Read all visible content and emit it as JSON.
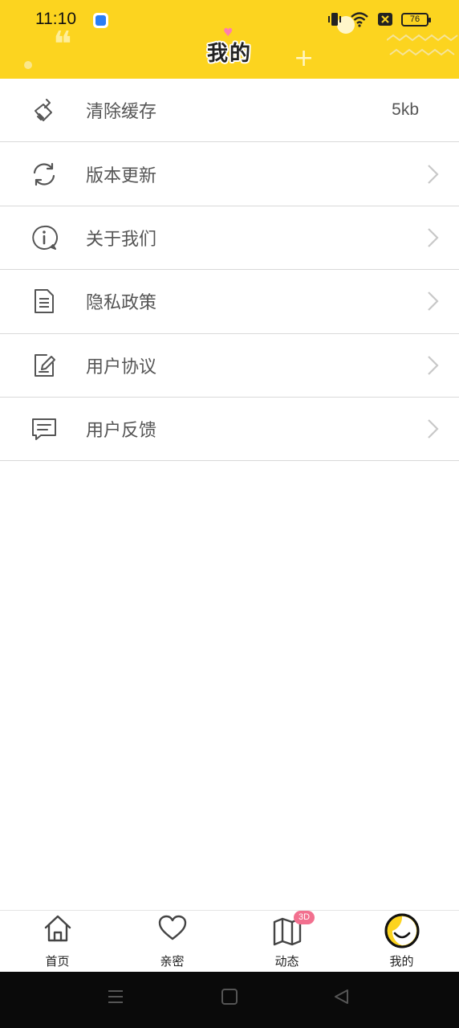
{
  "status_bar": {
    "time": "11:10",
    "battery": "76"
  },
  "header": {
    "title": "我的",
    "background_color": "#fcd41f"
  },
  "menu": {
    "items": [
      {
        "label": "清除缓存",
        "value": "5kb",
        "icon": "broom-icon"
      },
      {
        "label": "版本更新",
        "icon": "refresh-icon"
      },
      {
        "label": "关于我们",
        "icon": "info-bubble-icon"
      },
      {
        "label": "隐私政策",
        "icon": "document-icon"
      },
      {
        "label": "用户协议",
        "icon": "edit-note-icon"
      },
      {
        "label": "用户反馈",
        "icon": "message-icon"
      }
    ]
  },
  "tabbar": {
    "tabs": [
      {
        "label": "首页",
        "icon": "home-icon"
      },
      {
        "label": "亲密",
        "icon": "heart-icon"
      },
      {
        "label": "动态",
        "icon": "map-icon",
        "badge": "3D"
      },
      {
        "label": "我的",
        "icon": "smile-avatar-icon",
        "active": true
      }
    ]
  },
  "colors": {
    "accent": "#fcd41f",
    "badge": "#f2708f",
    "text": "#555555"
  }
}
